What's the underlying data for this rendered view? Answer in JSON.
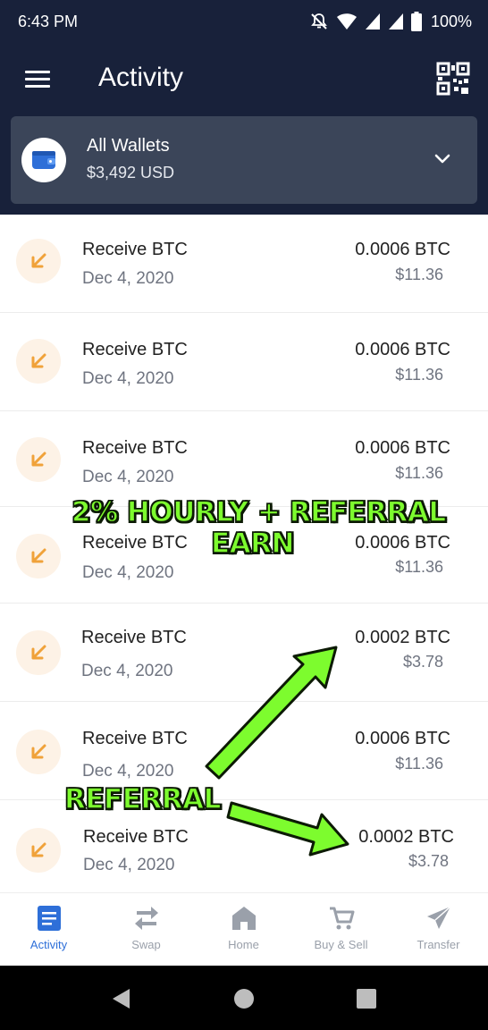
{
  "status_bar": {
    "time": "6:43 PM",
    "battery": "100%"
  },
  "header": {
    "title": "Activity"
  },
  "wallet": {
    "name": "All Wallets",
    "balance": "$3,492 USD"
  },
  "transactions": [
    {
      "title": "Receive BTC",
      "date": "Dec 4, 2020",
      "amount": "0.0006 BTC",
      "fiat": "$11.36"
    },
    {
      "title": "Receive BTC",
      "date": "Dec 4, 2020",
      "amount": "0.0006 BTC",
      "fiat": "$11.36"
    },
    {
      "title": "Receive BTC",
      "date": "Dec 4, 2020",
      "amount": "0.0006 BTC",
      "fiat": "$11.36"
    },
    {
      "title": "Receive BTC",
      "date": "Dec 4, 2020",
      "amount": "0.0006 BTC",
      "fiat": "$11.36"
    },
    {
      "title": "Receive BTC",
      "date": "Dec 4, 2020",
      "amount": "0.0002 BTC",
      "fiat": "$3.78"
    },
    {
      "title": "Receive BTC",
      "date": "Dec 4, 2020",
      "amount": "0.0006 BTC",
      "fiat": "$11.36"
    },
    {
      "title": "Receive BTC",
      "date": "Dec 4, 2020",
      "amount": "0.0002 BTC",
      "fiat": "$3.78"
    }
  ],
  "annotations": {
    "line1": "2% HOURLY + REFERRAL",
    "line2": "EARN",
    "referral": "REFERRAL",
    "color": "#7dfc2e"
  },
  "nav": [
    {
      "label": "Activity",
      "icon": "activity-icon",
      "active": true
    },
    {
      "label": "Swap",
      "icon": "swap-icon"
    },
    {
      "label": "Home",
      "icon": "home-icon"
    },
    {
      "label": "Buy & Sell",
      "icon": "cart-icon"
    },
    {
      "label": "Transfer",
      "icon": "send-icon"
    }
  ],
  "colors": {
    "header_bg": "#18213a",
    "wallet_card_bg": "#3b4559",
    "accent": "#2e6fd8",
    "receive_icon": "#f0a23a",
    "receive_icon_bg": "#fdf2e6"
  }
}
